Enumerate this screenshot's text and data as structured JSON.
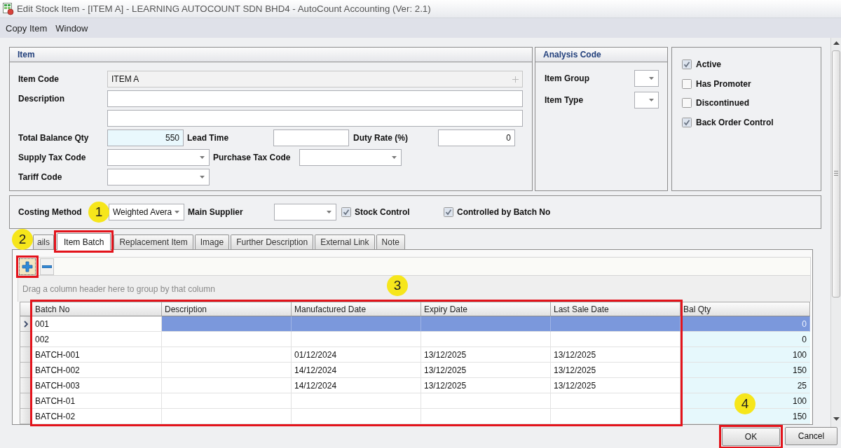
{
  "window": {
    "title": "Edit Stock Item - [ITEM A] - LEARNING AUTOCOUNT SDN BHD4 - AutoCount Accounting (Ver: 2.1)"
  },
  "menu": [
    "Copy Item",
    "Window"
  ],
  "item_group": {
    "title": "Item",
    "item_code": {
      "label": "Item Code",
      "value": "ITEM A"
    },
    "description": {
      "label": "Description"
    },
    "total_balance_qty": {
      "label": "Total Balance Qty",
      "value": "550"
    },
    "lead_time": {
      "label": "Lead Time"
    },
    "duty_rate": {
      "label": "Duty Rate (%)",
      "value": "0"
    },
    "supply_tax_code": {
      "label": "Supply Tax Code"
    },
    "purchase_tax_code": {
      "label": "Purchase Tax Code"
    },
    "tariff_code": {
      "label": "Tariff Code"
    }
  },
  "analysis_code": {
    "title": "Analysis Code",
    "fields": [
      {
        "label": "Item Group"
      },
      {
        "label": "Item Type"
      }
    ]
  },
  "options": [
    {
      "label": "Active",
      "checked": true
    },
    {
      "label": "Has Promoter",
      "checked": false
    },
    {
      "label": "Discontinued",
      "checked": false
    },
    {
      "label": "Back Order Control",
      "checked": true
    }
  ],
  "costing": {
    "costing_method": {
      "label": "Costing Method",
      "value": "Weighted Avera",
      "callout": "1"
    },
    "main_supplier": {
      "label": "Main Supplier"
    },
    "stock_control": {
      "label": "Stock Control",
      "checked": true
    },
    "controlled_by_batch_no": {
      "label": "Controlled by Batch No",
      "checked": true
    }
  },
  "tabs": {
    "callout": "2",
    "items": [
      {
        "label": "ails",
        "selected": false,
        "highlighted": false
      },
      {
        "label": "Item Batch",
        "selected": true,
        "highlighted": true
      },
      {
        "label": "Replacement Item",
        "selected": false,
        "highlighted": false
      },
      {
        "label": "Image",
        "selected": false,
        "highlighted": false
      },
      {
        "label": "Further Description",
        "selected": false,
        "highlighted": false
      },
      {
        "label": "External Link",
        "selected": false,
        "highlighted": false
      },
      {
        "label": "Note",
        "selected": false,
        "highlighted": false
      }
    ]
  },
  "batch_panel": {
    "toolbar": [
      {
        "kind": "add",
        "highlighted": true
      },
      {
        "kind": "remove",
        "highlighted": false
      }
    ],
    "group_hint": "Drag a column header here to group by that column",
    "callout": "3",
    "columns": [
      {
        "label": "Batch No",
        "kind": "text",
        "highlighted": true
      },
      {
        "label": "Description",
        "kind": "text",
        "highlighted": true
      },
      {
        "label": "Manufactured Date",
        "kind": "text",
        "highlighted": true
      },
      {
        "label": "Expiry Date",
        "kind": "text",
        "highlighted": true
      },
      {
        "label": "Last Sale Date",
        "kind": "text",
        "highlighted": true
      },
      {
        "label": "Bal Qty",
        "kind": "number",
        "highlighted": false
      }
    ],
    "rows": [
      {
        "selected": true,
        "batch_no": "001",
        "bal_qty": "0"
      },
      {
        "selected": false,
        "batch_no": "002",
        "bal_qty": "0"
      },
      {
        "selected": false,
        "batch_no": "BATCH-001",
        "manufactured_date": "01/12/2024",
        "expiry_date": "13/12/2025",
        "last_sale_date": "13/12/2025",
        "bal_qty": "100"
      },
      {
        "selected": false,
        "batch_no": "BATCH-002",
        "manufactured_date": "14/12/2024",
        "expiry_date": "13/12/2025",
        "last_sale_date": "13/12/2025",
        "bal_qty": "150"
      },
      {
        "selected": false,
        "batch_no": "BATCH-003",
        "manufactured_date": "14/12/2024",
        "expiry_date": "13/12/2025",
        "last_sale_date": "13/12/2025",
        "bal_qty": "25"
      },
      {
        "selected": false,
        "batch_no": "BATCH-01",
        "bal_qty": "100"
      },
      {
        "selected": false,
        "batch_no": "BATCH-02",
        "bal_qty": "150"
      }
    ]
  },
  "buttons": {
    "callout": "4",
    "items": [
      {
        "label": "OK",
        "highlighted": true
      },
      {
        "label": "Cancel",
        "highlighted": false
      }
    ]
  }
}
